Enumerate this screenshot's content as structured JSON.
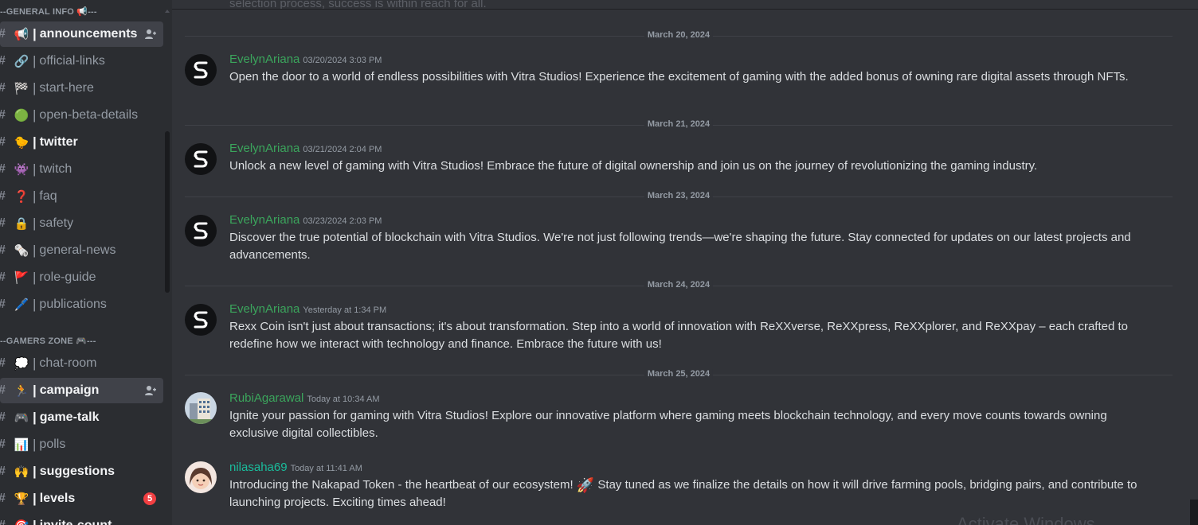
{
  "sidebar": {
    "categories": [
      {
        "label": "--GENERAL INFO 📢---"
      },
      {
        "label": "--GAMERS ZONE 🎮---"
      }
    ],
    "channels": [
      {
        "emoji": "📢",
        "name": "announcements"
      },
      {
        "emoji": "🔗",
        "name": "official-links"
      },
      {
        "emoji": "🏁",
        "name": "start-here"
      },
      {
        "emoji": "🟢",
        "name": "open-beta-details"
      },
      {
        "emoji": "🐤",
        "name": "twitter"
      },
      {
        "emoji": "👾",
        "name": "twitch"
      },
      {
        "emoji": "❓",
        "name": "faq"
      },
      {
        "emoji": "🔒",
        "name": "safety"
      },
      {
        "emoji": "🗞️",
        "name": "general-news"
      },
      {
        "emoji": "🚩",
        "name": "role-guide"
      },
      {
        "emoji": "🖊️",
        "name": "publications"
      },
      {
        "emoji": "💭",
        "name": "chat-room"
      },
      {
        "emoji": "🏃",
        "name": "campaign"
      },
      {
        "emoji": "🎮",
        "name": "game-talk"
      },
      {
        "emoji": "📊",
        "name": "polls"
      },
      {
        "emoji": "🙌",
        "name": "suggestions"
      },
      {
        "emoji": "🏆",
        "name": "levels",
        "badge": "5"
      },
      {
        "emoji": "🎯",
        "name": "invite-count"
      }
    ]
  },
  "main": {
    "top_partial_text": "selection process, success is within reach for all.",
    "dividers": [
      {
        "label": "March 20, 2024"
      },
      {
        "label": "March 21, 2024"
      },
      {
        "label": "March 23, 2024"
      },
      {
        "label": "March 24, 2024"
      },
      {
        "label": "March 25, 2024"
      }
    ],
    "messages": [
      {
        "author": "EvelynAriana",
        "time": "03/20/2024 3:03 PM",
        "text": "Open the door to a world of endless possibilities with Vitra Studios! Experience the excitement of gaming with the added bonus of owning rare digital assets through NFTs."
      },
      {
        "author": "EvelynAriana",
        "time": "03/21/2024 2:04 PM",
        "text": "Unlock a new level of gaming with Vitra Studios! Embrace the future of digital ownership and join us on the journey of revolutionizing the gaming industry."
      },
      {
        "author": "EvelynAriana",
        "time": "03/23/2024 2:03 PM",
        "text": "Discover the true potential of blockchain with Vitra Studios. We're not just following trends—we're shaping the future. Stay connected for updates on our latest projects and advancements."
      },
      {
        "author": "EvelynAriana",
        "time": "Yesterday at 1:34 PM",
        "text": "Rexx Coin isn't just about transactions; it's about transformation. Step into a world of innovation with ReXXverse, ReXXpress, ReXXplorer, and ReXXpay – each crafted to redefine how we interact with technology and finance. Embrace the future with us!"
      },
      {
        "author": "RubiAgarawal",
        "time": "Today at 10:34 AM",
        "text": "Ignite your passion for gaming with Vitra Studios! Explore our innovative platform where gaming meets blockchain technology, and every move counts towards owning exclusive digital collectibles."
      },
      {
        "author": "nilasaha69",
        "time": "Today at 11:41 AM",
        "text_before": "Introducing the Nakapad Token - the heartbeat of our ecosystem! ",
        "emoji": "🚀",
        "text_after": " Stay tuned as we finalize the details on how it will drive farming pools, bridging pairs, and contribute to launching projects. Exciting times ahead!"
      }
    ],
    "watermark": "Activate Windows"
  }
}
